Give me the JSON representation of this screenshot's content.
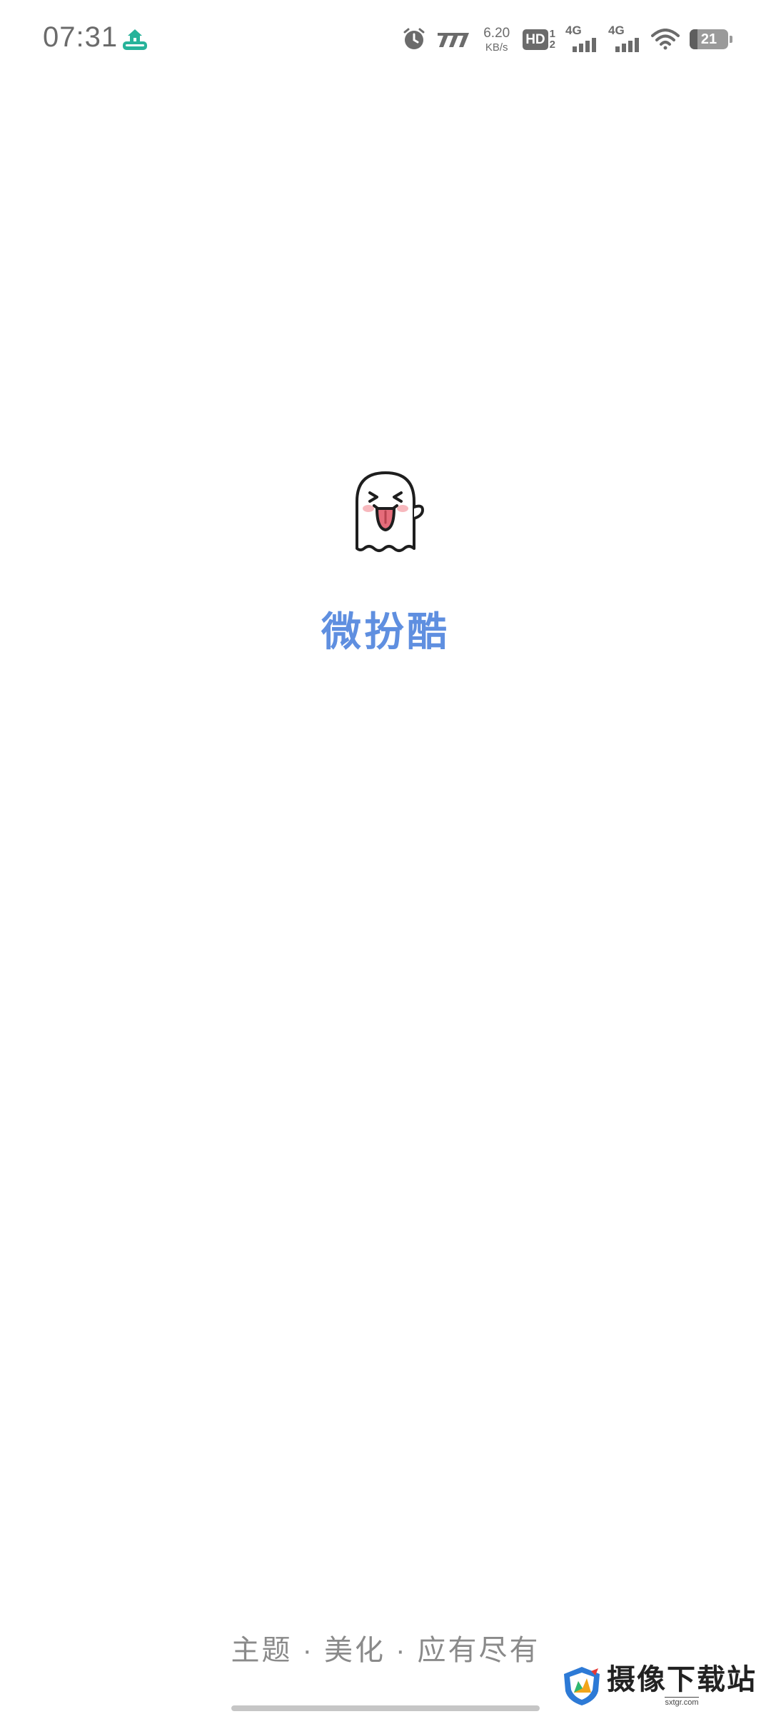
{
  "status_bar": {
    "time": "07:31",
    "network_speed_value": "6.20",
    "network_speed_unit": "KB/s",
    "hd_label": "HD",
    "hd_sim1": "1",
    "hd_sim2": "2",
    "signal1_label": "4G",
    "signal2_label": "4G",
    "battery_level": "21",
    "icons": [
      "home-app-icon",
      "alarm-icon",
      "nfc-icon",
      "wifi-icon",
      "battery-icon"
    ]
  },
  "splash": {
    "app_name": "微扮酷",
    "slogan": "主题 · 美化 · 应有尽有",
    "logo": "ghost-logo"
  },
  "watermark": {
    "name": "摄像下载站",
    "url": "sxtgr.com"
  },
  "colors": {
    "accent": "#5f8fe0",
    "slogan_text": "#8a8a8a",
    "status_text": "#6b6b6b",
    "background": "#ffffff"
  }
}
